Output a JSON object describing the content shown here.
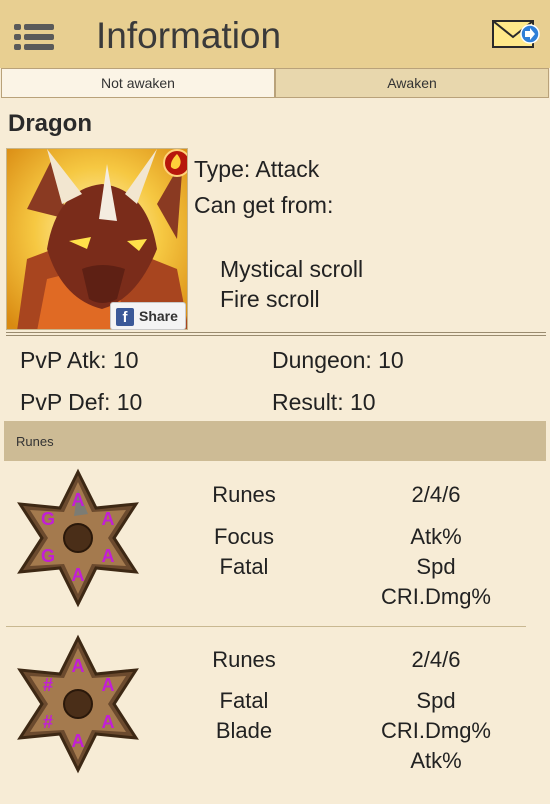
{
  "header": {
    "title": "Information",
    "menu_icon": "hamburger-menu-icon",
    "mail_icon": "mail-forward-icon"
  },
  "tabs": [
    {
      "label": "Not awaken",
      "active": true
    },
    {
      "label": "Awaken",
      "active": false
    }
  ],
  "monster": {
    "name": "Dragon",
    "element_badge": "fire-element-icon",
    "type_line": "Type: Attack",
    "source_heading": "Can get from:",
    "sources": [
      "Mystical scroll",
      "Fire scroll"
    ],
    "share_label": "Share"
  },
  "stats": {
    "pvp_atk": "PvP Atk: 10",
    "dungeon": "Dungeon: 10",
    "pvp_def": "PvP Def: 10",
    "result": "Result: 10"
  },
  "runes_section": {
    "label": "Runes"
  },
  "rune_sets": [
    {
      "header_left": "Runes",
      "header_right": "2/4/6",
      "sets": [
        "Focus",
        "Fatal"
      ],
      "stats": [
        "Atk%",
        "Spd",
        "CRI.Dmg%"
      ]
    },
    {
      "header_left": "Runes",
      "header_right": "2/4/6",
      "sets": [
        "Fatal",
        "Blade"
      ],
      "stats": [
        "Spd",
        "CRI.Dmg%",
        "Atk%"
      ]
    }
  ],
  "colors": {
    "topbar": "#e8cf91",
    "background": "#f7ecd6",
    "section_bar": "#cdbb95",
    "rune_glyph": "#c21ed6"
  }
}
